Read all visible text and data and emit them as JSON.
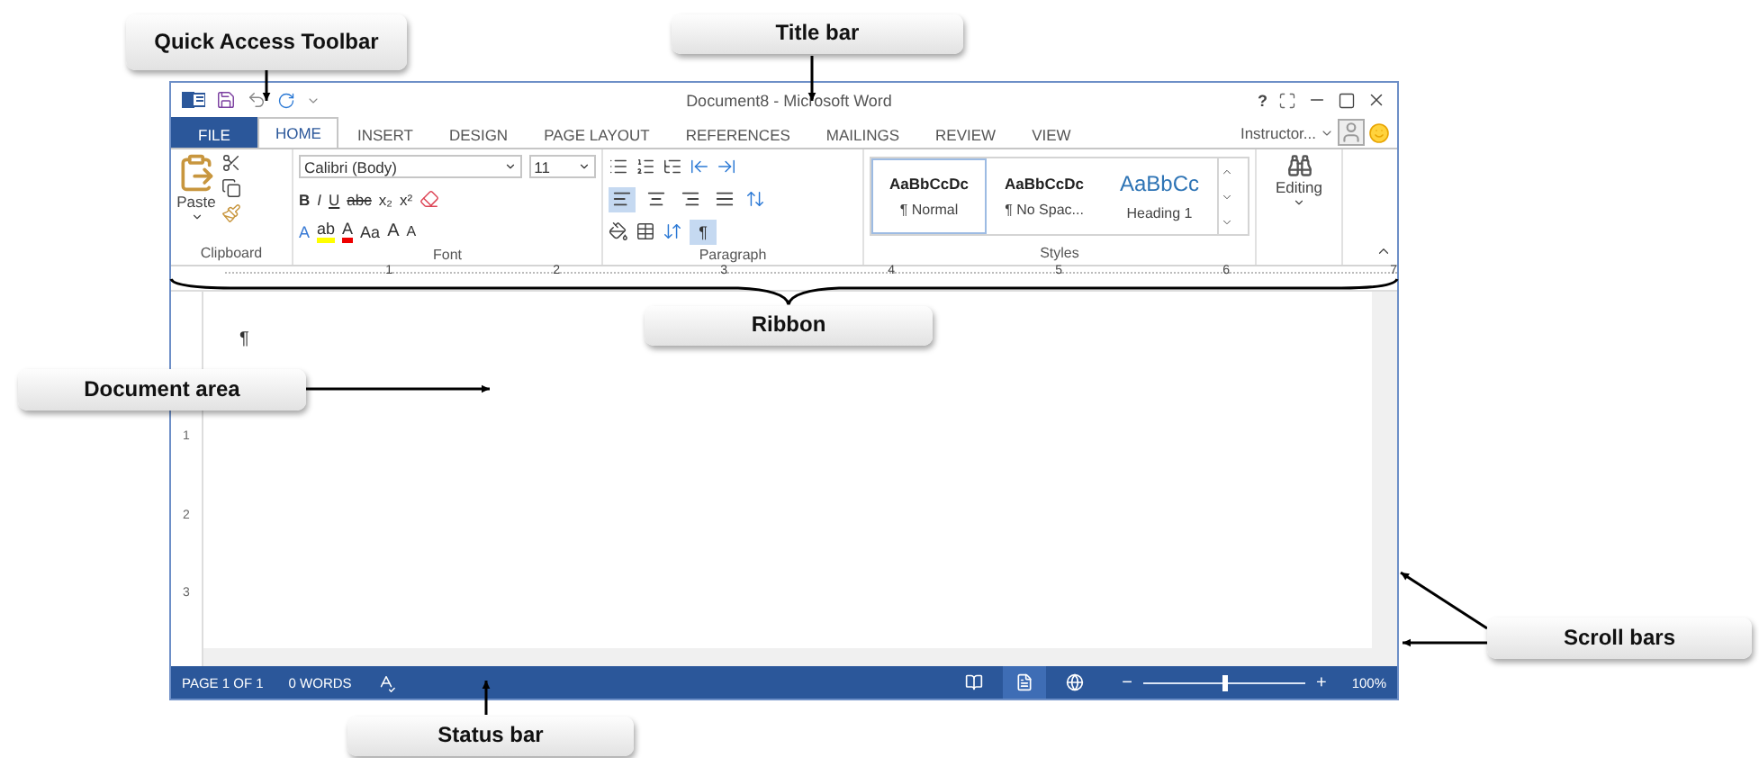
{
  "callouts": [
    {
      "label": "Quick Access Toolbar"
    },
    {
      "label": "Title bar"
    },
    {
      "label": "Ribbon"
    },
    {
      "label": "Document area"
    },
    {
      "label": "Scroll bars"
    },
    {
      "label": "Status bar"
    }
  ],
  "window": {
    "title": "Document8 - Microsoft Word",
    "help": "?"
  },
  "tabs": [
    {
      "label": "FILE",
      "kind": "file",
      "selected": false
    },
    {
      "label": "HOME",
      "kind": "tab",
      "selected": true
    },
    {
      "label": "INSERT",
      "kind": "tab",
      "selected": false
    },
    {
      "label": "DESIGN",
      "kind": "tab",
      "selected": false
    },
    {
      "label": "PAGE LAYOUT",
      "kind": "tab",
      "selected": false
    },
    {
      "label": "REFERENCES",
      "kind": "tab",
      "selected": false
    },
    {
      "label": "MAILINGS",
      "kind": "tab",
      "selected": false
    },
    {
      "label": "REVIEW",
      "kind": "tab",
      "selected": false
    },
    {
      "label": "VIEW",
      "kind": "tab",
      "selected": false
    }
  ],
  "account": {
    "name": "Instructor..."
  },
  "ribbon": {
    "clipboard": {
      "paste": "Paste",
      "label": "Clipboard"
    },
    "font": {
      "name": "Calibri (Body)",
      "size": "11",
      "label": "Font",
      "format_buttons": [
        {
          "text": "B",
          "kind": "bold"
        },
        {
          "text": "I",
          "kind": "italic"
        },
        {
          "text": "U",
          "kind": "underline"
        },
        {
          "text": "abc",
          "kind": "strike"
        },
        {
          "text": "x₂",
          "kind": "plain"
        },
        {
          "text": "x²",
          "kind": "plain"
        }
      ],
      "effect_buttons": [
        {
          "text": "A",
          "kind": "effects"
        },
        {
          "text": "ab",
          "kind": "highlight"
        },
        {
          "text": "A",
          "kind": "color"
        },
        {
          "text": "Aa",
          "kind": "plain"
        },
        {
          "text": "A",
          "kind": "grow"
        },
        {
          "text": "A",
          "kind": "shrink"
        }
      ]
    },
    "paragraph": {
      "label": "Paragraph",
      "align": [
        {
          "kind": "left",
          "selected": true
        },
        {
          "kind": "center",
          "selected": false
        },
        {
          "kind": "right",
          "selected": false
        },
        {
          "kind": "justify",
          "selected": false
        }
      ],
      "show_marks": {
        "text": "¶",
        "selected": true
      }
    },
    "styles": {
      "label": "Styles",
      "items": [
        {
          "preview": "AaBbCcDc",
          "name": "¶ Normal",
          "kind": "body",
          "selected": true
        },
        {
          "preview": "AaBbCcDc",
          "name": "¶ No Spac...",
          "kind": "body",
          "selected": false
        },
        {
          "preview": "AaBbCc",
          "name": "Heading 1",
          "kind": "heading",
          "selected": false
        }
      ]
    },
    "editing": {
      "label": "Editing"
    }
  },
  "ruler": [
    "1",
    "2",
    "3",
    "4",
    "5",
    "6",
    "7"
  ],
  "vertical_ruler": [
    "1",
    "2",
    "3"
  ],
  "document": {
    "mark": "¶"
  },
  "status_bar": {
    "page": "PAGE 1 OF 1",
    "words": "0 WORDS",
    "views": [
      {
        "kind": "read",
        "selected": false
      },
      {
        "kind": "print",
        "selected": true
      },
      {
        "kind": "web",
        "selected": false
      }
    ],
    "zoom_out": "−",
    "zoom_in": "+",
    "zoom_slider": {
      "level": 0.5
    },
    "zoom": "100%"
  }
}
